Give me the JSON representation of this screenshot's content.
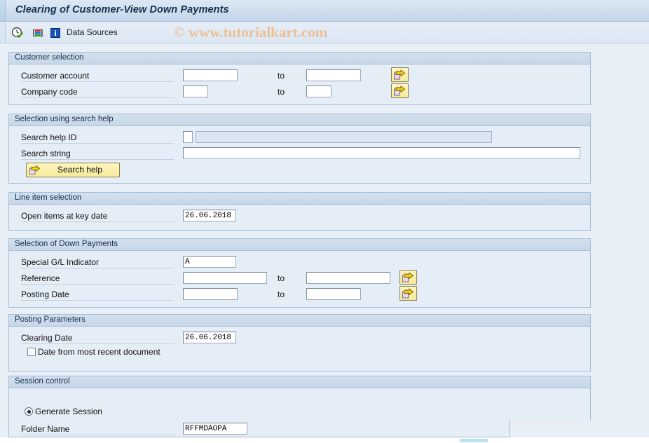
{
  "window": {
    "title": "Clearing of Customer-View Down Payments"
  },
  "toolbar": {
    "execute_icon": "execute-clock-check-icon",
    "variants_icon": "get-variant-icon",
    "info_icon": "information-icon",
    "data_sources_label": "Data Sources"
  },
  "watermark": {
    "text": "© www.tutorialkart.com",
    "color": "#edbe96"
  },
  "labels": {
    "to": "to"
  },
  "groups": {
    "customer_selection": {
      "title": "Customer selection",
      "rows": [
        {
          "label": "Customer account",
          "from_value": "",
          "to_label": "to",
          "to_value": "",
          "multi_select_icon": "multiple-selection-arrow-icon"
        },
        {
          "label": "Company code",
          "from_value": "",
          "to_label": "to",
          "to_value": "",
          "multi_select_icon": "multiple-selection-arrow-icon"
        }
      ]
    },
    "search_help": {
      "title": "Selection using search help",
      "rows": [
        {
          "label": "Search help ID",
          "id_value": "",
          "desc_value": ""
        },
        {
          "label": "Search string",
          "value": ""
        }
      ],
      "button": {
        "label": "Search help",
        "icon": "arrow-right-page-icon"
      }
    },
    "line_item_selection": {
      "title": "Line item selection",
      "rows": [
        {
          "label": "Open items at key date",
          "value": "26.06.2018"
        }
      ]
    },
    "down_payments": {
      "title": "Selection of Down Payments",
      "rows": [
        {
          "label": "Special G/L Indicator",
          "value": "A"
        },
        {
          "label": "Reference",
          "from_value": "",
          "to_label": "to",
          "to_value": "",
          "multi_select_icon": "multiple-selection-arrow-icon"
        },
        {
          "label": "Posting Date",
          "from_value": "",
          "to_label": "to",
          "to_value": "",
          "multi_select_icon": "multiple-selection-arrow-icon"
        }
      ]
    },
    "posting_parameters": {
      "title": "Posting Parameters",
      "rows": [
        {
          "label": "Clearing Date",
          "value": "26.06.2018"
        }
      ],
      "checkbox": {
        "label": "Date from most recent document",
        "checked": false
      }
    },
    "session_control": {
      "title": "Session control",
      "radio": {
        "label": "Generate Session",
        "checked": true
      },
      "rows": [
        {
          "label": "Folder Name",
          "value": "RFFMDAOPA"
        }
      ]
    }
  }
}
